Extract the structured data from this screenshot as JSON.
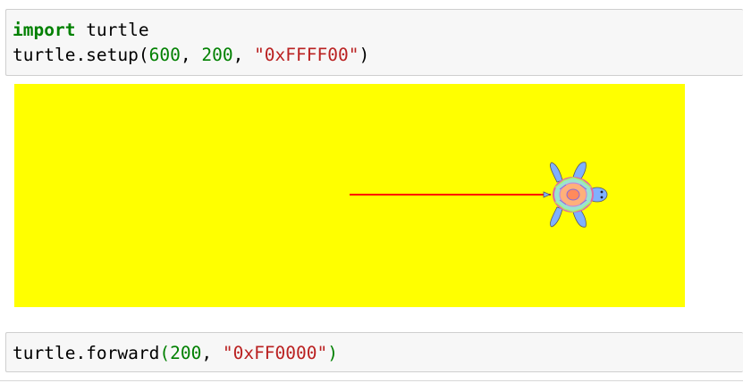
{
  "cell1": {
    "line1": {
      "keyword": "import",
      "rest": " turtle"
    },
    "line2": {
      "prefix": "turtle.setup(",
      "arg1": "600",
      "sep1": ", ",
      "arg2": "200",
      "sep2": ", ",
      "arg3": "\"0xFFFF00\"",
      "suffix": ")"
    }
  },
  "canvas": {
    "background": "#ffff00",
    "line_color": "#ff0000",
    "turtle_icon": "turtle-sprite-icon"
  },
  "cell2": {
    "prefix": "turtle.forward",
    "open": "(",
    "arg1": "200",
    "sep": ", ",
    "arg2": "\"0xFF0000\"",
    "close": ")"
  }
}
